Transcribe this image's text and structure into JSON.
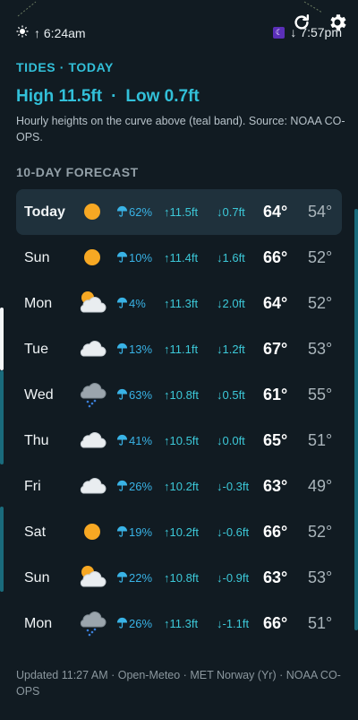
{
  "header": {
    "sunrise": "↑ 6:24am",
    "sunset": "↓ 7:57pm",
    "sunrise_icon": "sun-icon",
    "moon_icon": "moon-phase-icon",
    "refresh_icon": "refresh-icon",
    "settings_icon": "gear-icon"
  },
  "tides": {
    "title": "TIDES · TODAY",
    "high": "High 11.5ft",
    "separator": "·",
    "low": "Low 0.7ft",
    "description": "Hourly heights on the curve above (teal band). Source: NOAA CO-OPS."
  },
  "forecast": {
    "title": "10-DAY FORECAST",
    "days": [
      {
        "day": "Today",
        "icon": "sun",
        "pop": "62%",
        "hi_tide": "↑11.5ft",
        "lo_tide": "↓0.7ft",
        "hi": "64°",
        "lo": "54°"
      },
      {
        "day": "Sun",
        "icon": "sun",
        "pop": "10%",
        "hi_tide": "↑11.4ft",
        "lo_tide": "↓1.6ft",
        "hi": "66°",
        "lo": "52°"
      },
      {
        "day": "Mon",
        "icon": "partly-cloudy",
        "pop": "4%",
        "hi_tide": "↑11.3ft",
        "lo_tide": "↓2.0ft",
        "hi": "64°",
        "lo": "52°"
      },
      {
        "day": "Tue",
        "icon": "cloud",
        "pop": "13%",
        "hi_tide": "↑11.1ft",
        "lo_tide": "↓1.2ft",
        "hi": "67°",
        "lo": "53°"
      },
      {
        "day": "Wed",
        "icon": "rain-cloud",
        "pop": "63%",
        "hi_tide": "↑10.8ft",
        "lo_tide": "↓0.5ft",
        "hi": "61°",
        "lo": "55°"
      },
      {
        "day": "Thu",
        "icon": "cloud",
        "pop": "41%",
        "hi_tide": "↑10.5ft",
        "lo_tide": "↓0.0ft",
        "hi": "65°",
        "lo": "51°"
      },
      {
        "day": "Fri",
        "icon": "cloud",
        "pop": "26%",
        "hi_tide": "↑10.2ft",
        "lo_tide": "↓-0.3ft",
        "hi": "63°",
        "lo": "49°"
      },
      {
        "day": "Sat",
        "icon": "sun",
        "pop": "19%",
        "hi_tide": "↑10.2ft",
        "lo_tide": "↓-0.6ft",
        "hi": "66°",
        "lo": "52°"
      },
      {
        "day": "Sun",
        "icon": "partly-cloudy",
        "pop": "22%",
        "hi_tide": "↑10.8ft",
        "lo_tide": "↓-0.9ft",
        "hi": "63°",
        "lo": "53°"
      },
      {
        "day": "Mon",
        "icon": "rain-cloud",
        "pop": "26%",
        "hi_tide": "↑11.3ft",
        "lo_tide": "↓-1.1ft",
        "hi": "66°",
        "lo": "51°"
      }
    ]
  },
  "footer": {
    "text": "Updated 11:27 AM · Open-Meteo · MET Norway (Yr) · NOAA CO-OPS"
  },
  "colors": {
    "background": "#111b22",
    "accent": "#32c0d9",
    "today_highlight": "#1f313c",
    "sun": "#f7a823"
  }
}
